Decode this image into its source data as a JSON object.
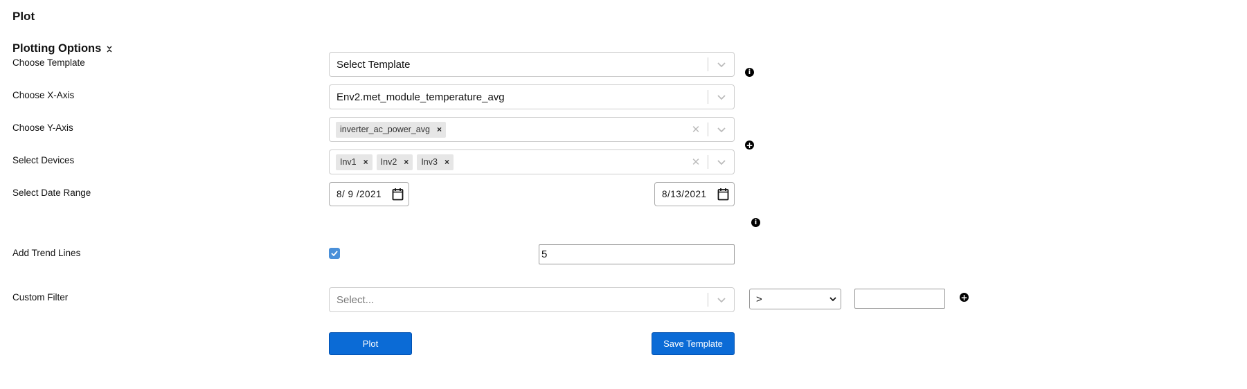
{
  "page": {
    "title": "Plot"
  },
  "section": {
    "title": "Plotting Options",
    "toggle_icon": "chevrons-collapse-icon"
  },
  "rows": {
    "template": {
      "label": "Choose Template",
      "value": "Select Template"
    },
    "x_axis": {
      "label": "Choose X-Axis",
      "value": "Env2.met_module_temperature_avg"
    },
    "y_axis": {
      "label": "Choose Y-Axis",
      "chips": [
        "inverter_ac_power_avg"
      ]
    },
    "devices": {
      "label": "Select Devices",
      "chips": [
        "Inv1",
        "Inv2",
        "Inv3"
      ]
    },
    "date_range": {
      "label": "Select Date Range",
      "start": "8/ 9 /2021",
      "end": "8/13/2021"
    },
    "trend_lines": {
      "label": "Add Trend Lines",
      "checked": true,
      "value": "5"
    },
    "custom_filter": {
      "label": "Custom Filter",
      "placeholder": "Select...",
      "operator": ">",
      "value": ""
    }
  },
  "buttons": {
    "plot": "Plot",
    "save_template": "Save Template"
  },
  "icons": {
    "chip_remove": "×",
    "clear": "✕",
    "info": "i",
    "add": "+"
  },
  "colors": {
    "primary_button": "#0b6bd6",
    "checkbox": "#4a90d9",
    "chip_bg": "#e6e6e6"
  }
}
